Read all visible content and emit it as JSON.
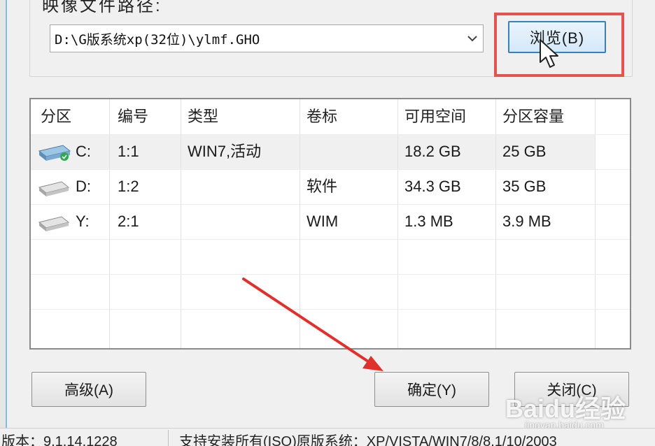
{
  "image_path_label": "映像文件路径:",
  "image_path": {
    "value": "D:\\G版系统xp(32位)\\ylmf.GHO",
    "dropdown_icon": "chevron-down-icon"
  },
  "browse_button": "浏览(B)",
  "partition_table": {
    "columns": [
      "分区",
      "编号",
      "类型",
      "卷标",
      "可用空间",
      "分区容量"
    ],
    "rows": [
      {
        "partition": "C:",
        "number": "1:1",
        "type": "WIN7,活动",
        "label": "",
        "free": "18.2 GB",
        "capacity": "25 GB",
        "icon": "system-drive-icon",
        "selected": true
      },
      {
        "partition": "D:",
        "number": "1:2",
        "type": "",
        "label": "软件",
        "free": "34.3 GB",
        "capacity": "35 GB",
        "icon": "hard-drive-icon",
        "selected": false
      },
      {
        "partition": "Y:",
        "number": "2:1",
        "type": "",
        "label": "WIM",
        "free": "1.3 MB",
        "capacity": "3.9 MB",
        "icon": "hard-drive-icon",
        "selected": false
      }
    ]
  },
  "buttons": {
    "advanced": "高级(A)",
    "ok": "确定(Y)",
    "close": "关闭(C)"
  },
  "status_bar": {
    "version": "版本：9.1.14.1228",
    "support": "支持安装所有(ISO)原版系统：XP/VISTA/WIN7/8/8.1/10/2003"
  },
  "watermark": {
    "text": "Baidu经验",
    "url": "jingyan.baidu.com"
  },
  "colors": {
    "highlight_box": "#e3544f",
    "arrow": "#e0302c",
    "browse_border": "#3c7fb1"
  }
}
